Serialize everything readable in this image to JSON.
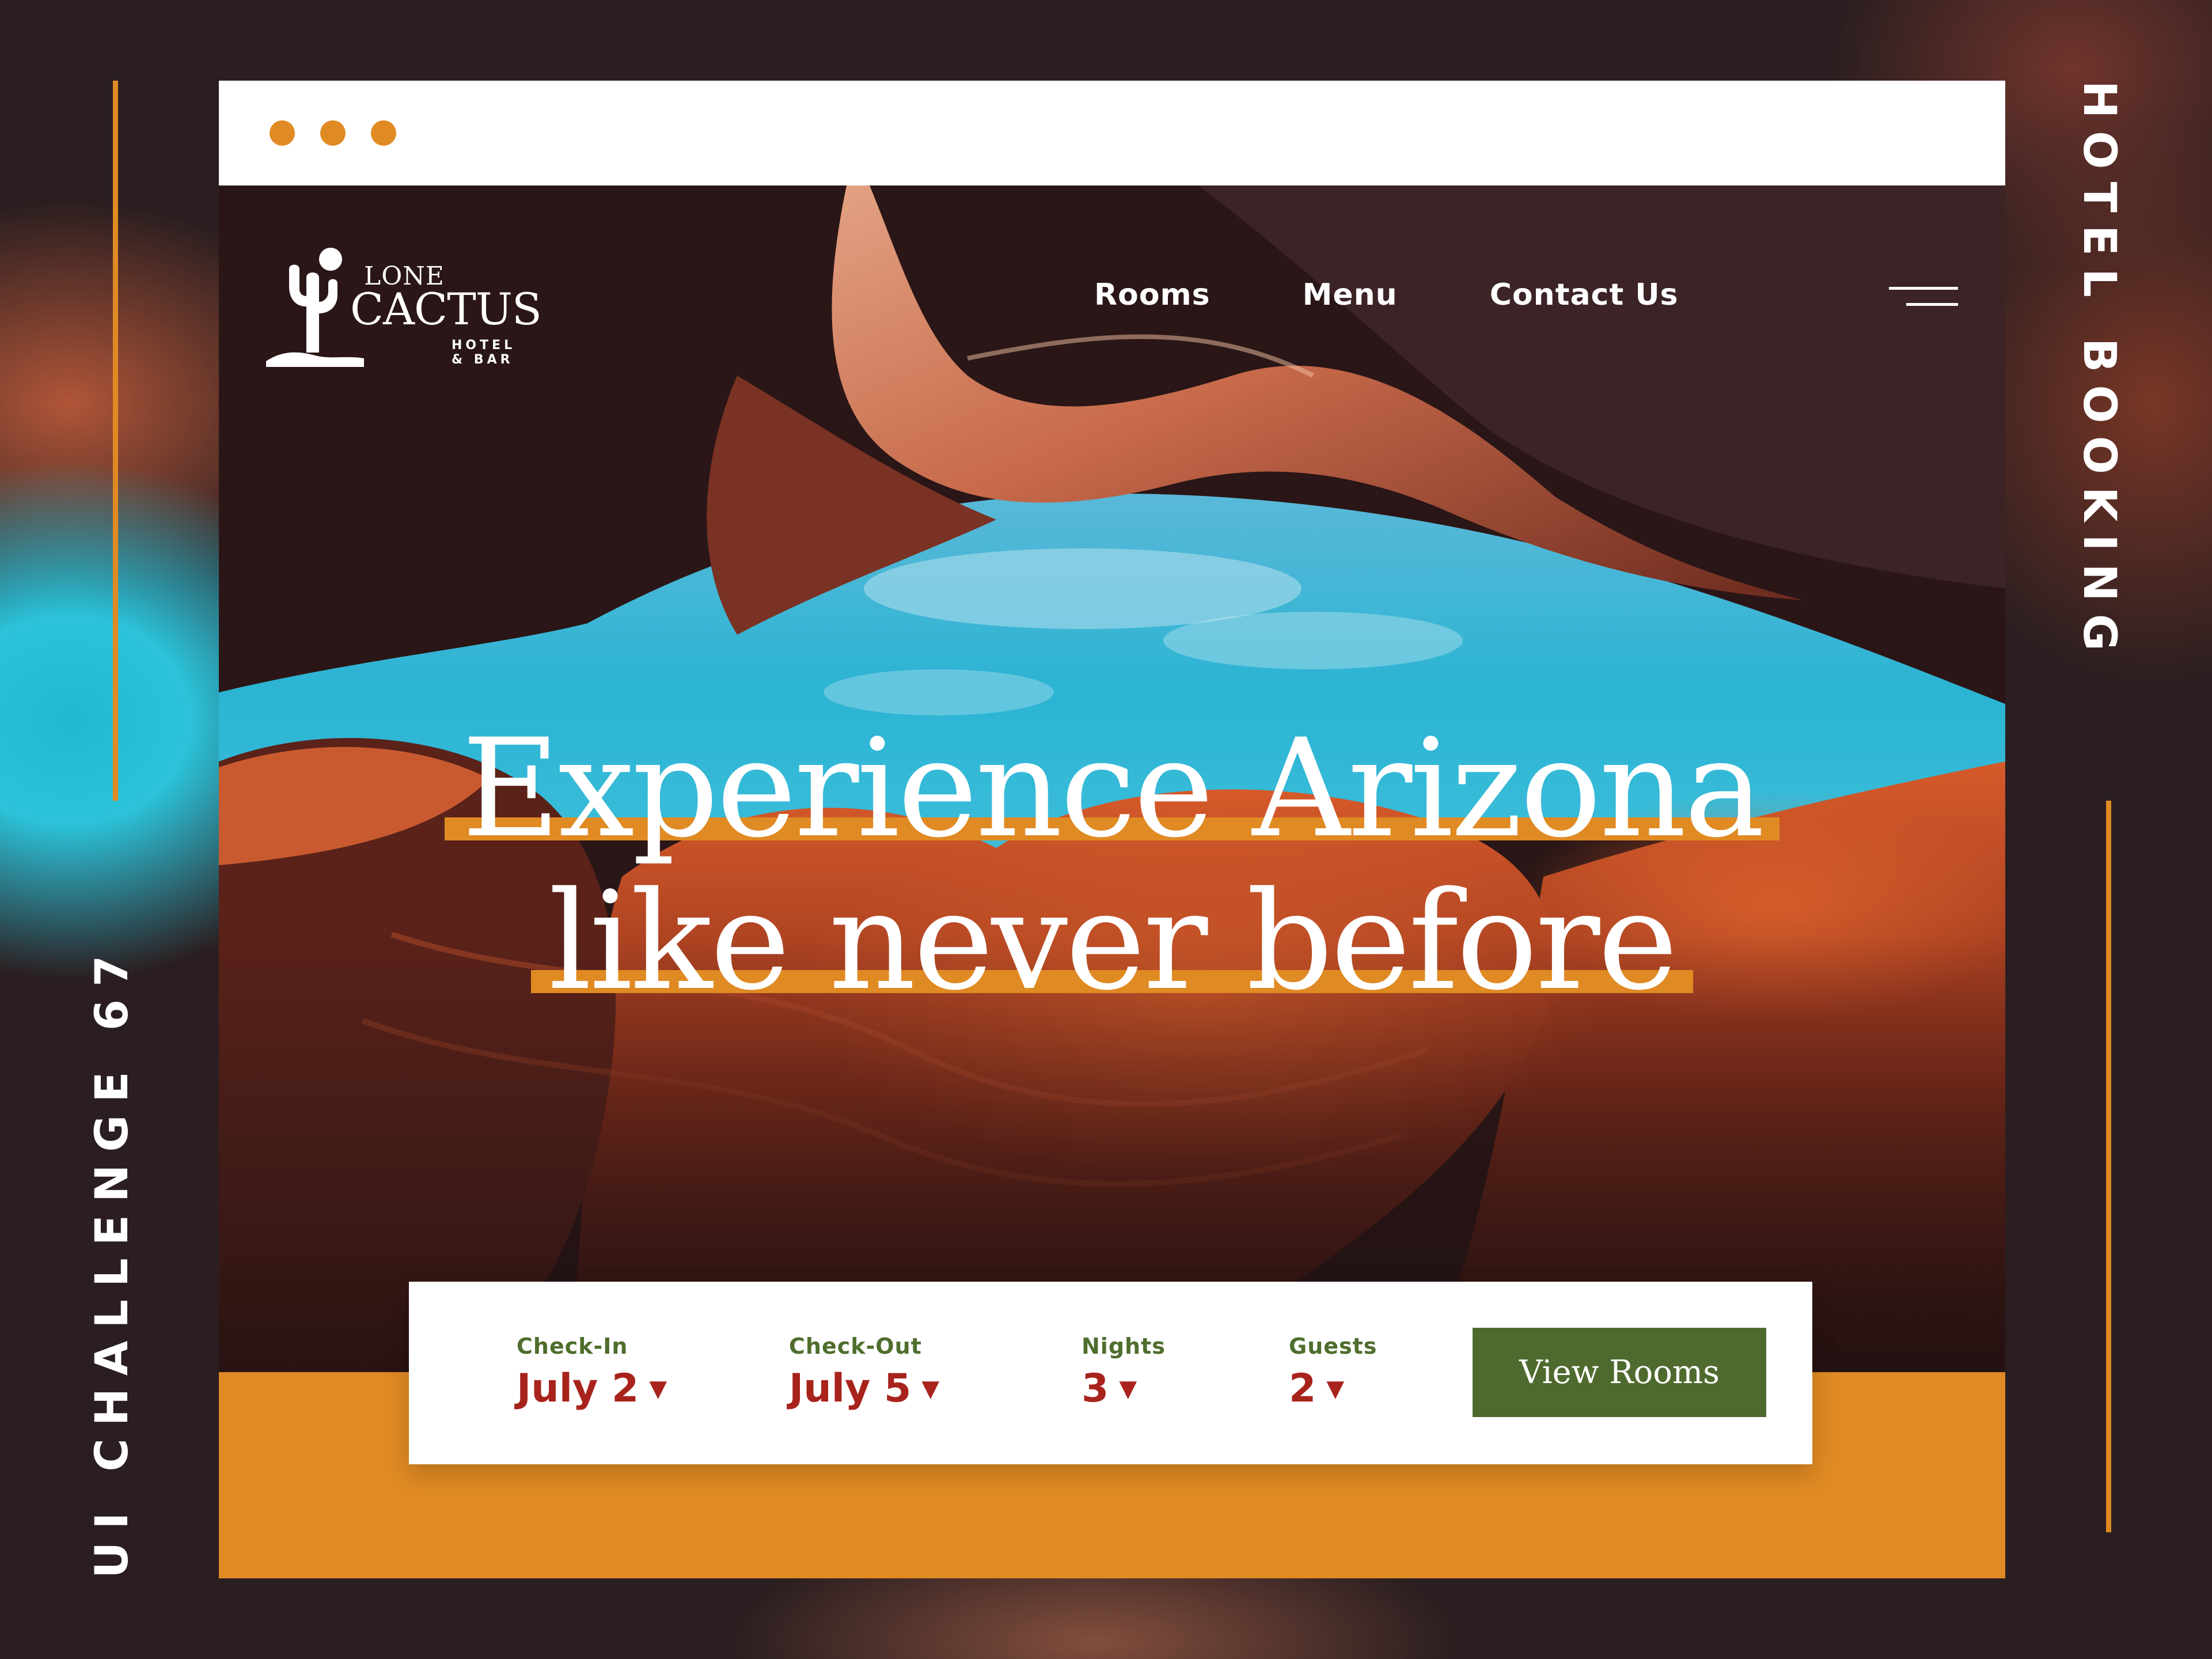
{
  "side": {
    "left_label": "UI CHALLENGE 67",
    "right_label": "HOTEL BOOKING"
  },
  "brand": {
    "name_top": "LONE",
    "name_main": "CACTUS",
    "tagline": "HOTEL & BAR"
  },
  "nav": {
    "items": [
      {
        "label": "Rooms"
      },
      {
        "label": "Menu"
      },
      {
        "label": "Contact  Us"
      }
    ]
  },
  "hero": {
    "headline_line1": "Experience Arizona",
    "headline_line2": "like never before"
  },
  "booking": {
    "checkin": {
      "label": "Check-In",
      "value": "July  2"
    },
    "checkout": {
      "label": "Check-Out",
      "value": "July  5"
    },
    "nights": {
      "label": "Nights",
      "value": "3"
    },
    "guests": {
      "label": "Guests",
      "value": "2"
    },
    "caret": "▼",
    "cta": "View Rooms"
  },
  "colors": {
    "accent_orange": "#e08a23",
    "label_green": "#4e6e2d",
    "value_red": "#a8231c",
    "button_green": "#4f6a2e",
    "sky_blue": "#2bb8d6"
  }
}
